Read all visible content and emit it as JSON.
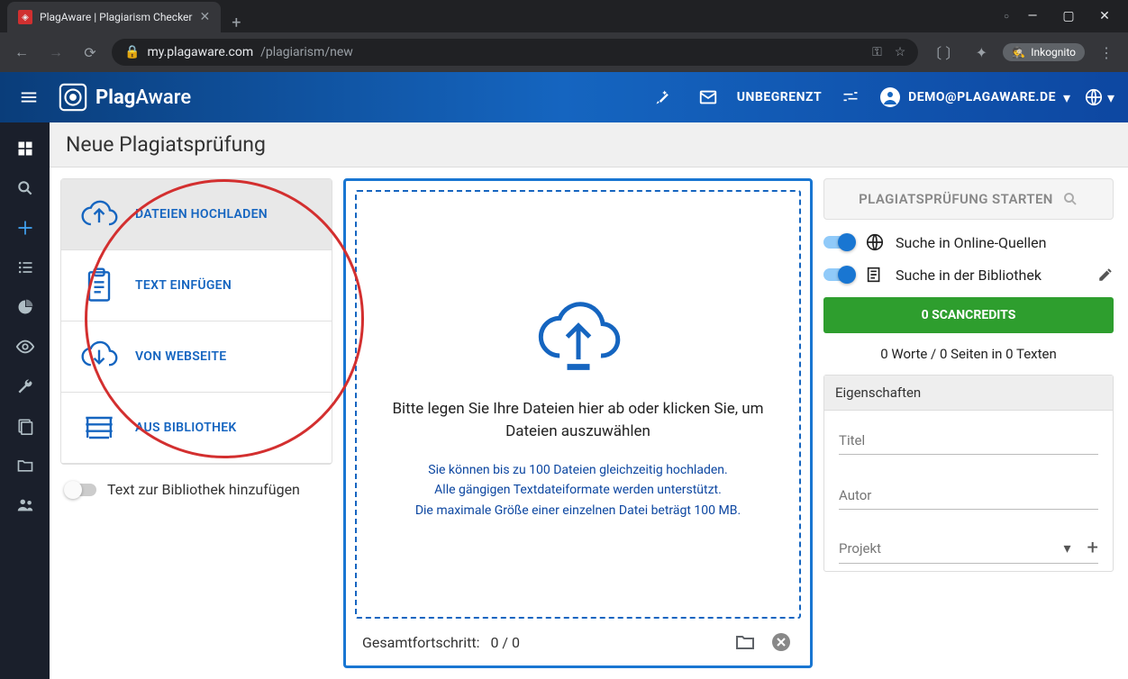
{
  "browser": {
    "tab_title": "PlagAware | Plagiarism Checker",
    "url_host": "my.plagaware.com",
    "url_path": "/plagiarism/new",
    "incognito": "Inkognito"
  },
  "header": {
    "brand_a": "Plag",
    "brand_b": "Aware",
    "unlimited": "UNBEGRENZT",
    "user": "DEMO@PLAGAWARE.DE"
  },
  "page": {
    "title": "Neue Plagiatsprüfung"
  },
  "methods": {
    "upload": "DATEIEN HOCHLADEN",
    "paste": "TEXT EINFÜGEN",
    "website": "VON WEBSEITE",
    "library": "AUS BIBLIOTHEK"
  },
  "lib_toggle_label": "Text zur Bibliothek hinzufügen",
  "dropzone": {
    "main": "Bitte legen Sie Ihre Dateien hier ab oder klicken Sie, um Dateien auszuwählen",
    "info1": "Sie können bis zu 100 Dateien gleichzeitig hochladen.",
    "info2": "Alle gängigen Textdateiformate werden unterstützt.",
    "info3": "Die maximale Größe einer einzelnen Datei beträgt 100 MB."
  },
  "progress": {
    "label": "Gesamtfortschritt:",
    "value": "0 / 0"
  },
  "right": {
    "start": "PLAGIATSPRÜFUNG STARTEN",
    "opt_online": "Suche in Online-Quellen",
    "opt_library": "Suche in der Bibliothek",
    "credits": "0 SCANCREDITS",
    "stats": "0 Worte / 0 Seiten in 0 Texten",
    "props_header": "Eigenschaften",
    "field_title": "Titel",
    "field_author": "Autor",
    "field_project": "Projekt"
  }
}
